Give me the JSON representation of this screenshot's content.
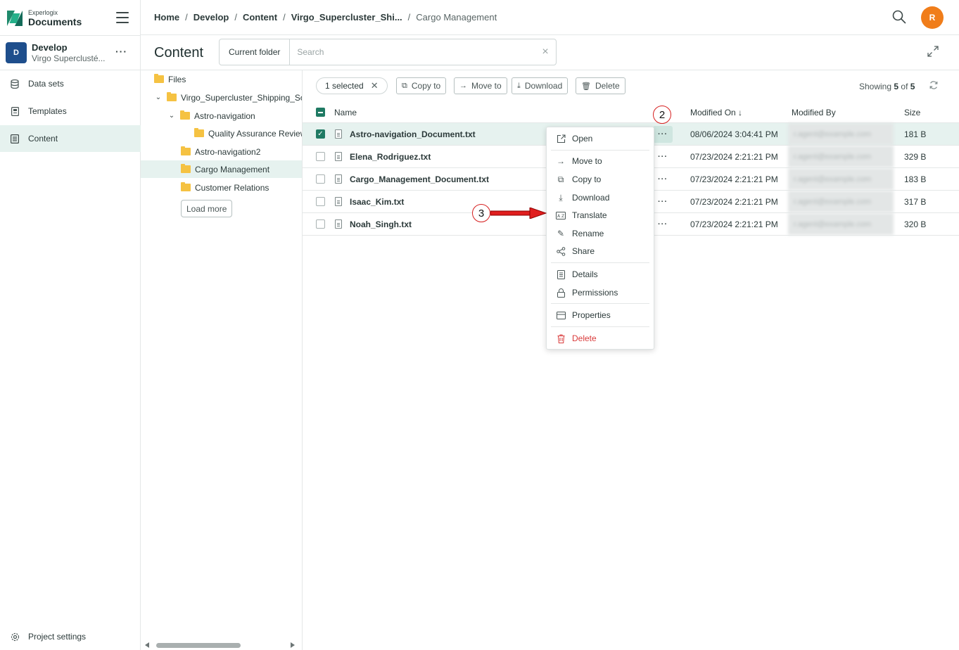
{
  "brand": {
    "small": "Experlogix",
    "big": "Documents"
  },
  "project": {
    "initial": "D",
    "name": "Develop",
    "sub": "Virgo Superclusté...",
    "more": "···"
  },
  "nav": {
    "items": [
      {
        "label": "Data sets",
        "icon": "database-icon"
      },
      {
        "label": "Templates",
        "icon": "template-icon"
      },
      {
        "label": "Content",
        "icon": "content-icon",
        "active": true
      }
    ],
    "settings": "Project settings"
  },
  "breadcrumb": [
    "Home",
    "Develop",
    "Content",
    "Virgo_Supercluster_Shi...",
    "Cargo Management"
  ],
  "user": {
    "initial": "R"
  },
  "colors": {
    "accent": "#1f7a63",
    "selected_bg": "#e6f2ef",
    "avatar": "#f07d1a",
    "project": "#1e4e8c",
    "danger": "#d93a3a",
    "folder": "#f5c242"
  },
  "content": {
    "title": "Content",
    "scope": "Current folder",
    "search_placeholder": "Search"
  },
  "tree": {
    "items": [
      {
        "label": "Files",
        "chevron": ""
      },
      {
        "label": "Virgo_Supercluster_Shipping_Sol",
        "chevron": "⌄"
      },
      {
        "label": "Astro-navigation",
        "chevron": "⌄"
      },
      {
        "label": "Quality Assurance Review",
        "chevron": ""
      },
      {
        "label": "Astro-navigation2",
        "chevron": ""
      },
      {
        "label": "Cargo Management",
        "chevron": ""
      },
      {
        "label": "Customer Relations",
        "chevron": ""
      }
    ],
    "load_more": "Load more"
  },
  "toolbar": {
    "selected": "1 selected",
    "copy": "Copy to",
    "move": "Move to",
    "download": "Download",
    "delete": "Delete",
    "showing_prefix": "Showing",
    "showing_count": "5",
    "showing_of": "of",
    "showing_total": "5"
  },
  "table": {
    "headers": {
      "name": "Name",
      "modified_on": "Modified On ↓",
      "modified_by": "Modified By",
      "size": "Size"
    },
    "rows": [
      {
        "name": "Astro-navigation_Document.txt",
        "modified": "08/06/2024 3:04:41 PM",
        "by": "r.agent@example.com",
        "size": "181 B",
        "checked": true
      },
      {
        "name": "Elena_Rodriguez.txt",
        "modified": "07/23/2024 2:21:21 PM",
        "by": "r.agent@example.com",
        "size": "329 B",
        "checked": false
      },
      {
        "name": "Cargo_Management_Document.txt",
        "modified": "07/23/2024 2:21:21 PM",
        "by": "r.agent@example.com",
        "size": "183 B",
        "checked": false
      },
      {
        "name": "Isaac_Kim.txt",
        "modified": "07/23/2024 2:21:21 PM",
        "by": "r.agent@example.com",
        "size": "317 B",
        "checked": false
      },
      {
        "name": "Noah_Singh.txt",
        "modified": "07/23/2024 2:21:21 PM",
        "by": "r.agent@example.com",
        "size": "320 B",
        "checked": false
      }
    ]
  },
  "menu": {
    "open": "Open",
    "move": "Move to",
    "copy": "Copy to",
    "download": "Download",
    "translate": "Translate",
    "rename": "Rename",
    "share": "Share",
    "details": "Details",
    "permissions": "Permissions",
    "properties": "Properties",
    "delete": "Delete"
  },
  "annotations": {
    "two": "2",
    "three": "3"
  }
}
